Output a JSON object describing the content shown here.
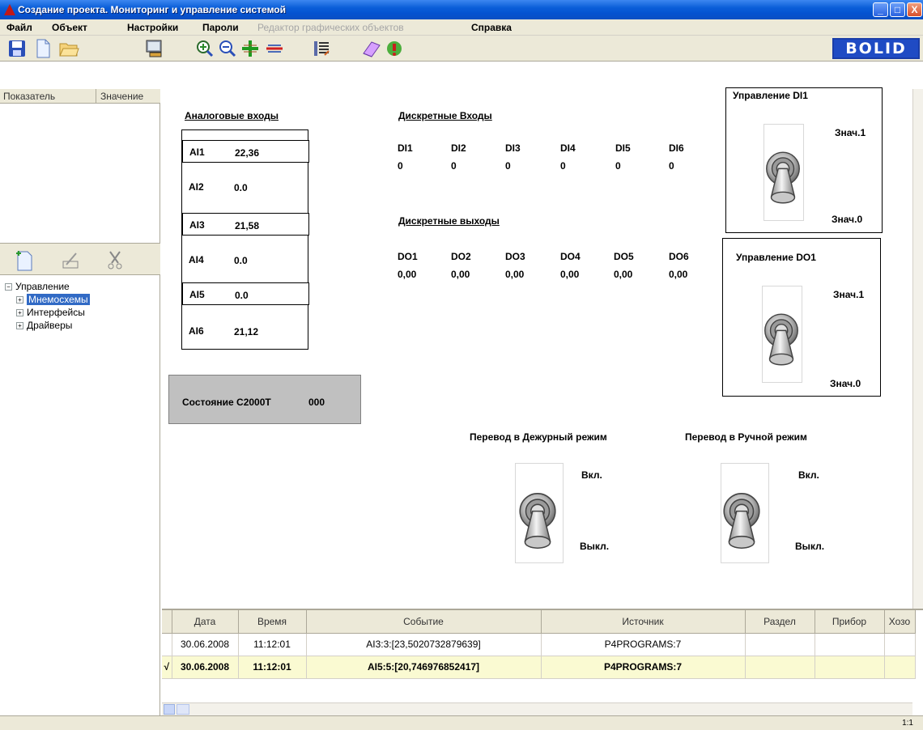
{
  "window": {
    "title": "Создание проекта. Мониторинг и управление системой",
    "min": "_",
    "max": "□",
    "close": "X"
  },
  "menu": [
    "Файл",
    "Объект",
    "Настройки",
    "Пароли",
    "Редактор графических объектов",
    "Справка"
  ],
  "logo": "BOLID",
  "left_panel": {
    "col_indicator": "Показатель",
    "col_value": "Значение",
    "tree": {
      "root": "Управление",
      "items": [
        "Мнемосхемы",
        "Интерфейсы",
        "Драйверы"
      ],
      "selected": "Мнемосхемы"
    }
  },
  "analog": {
    "header": "Аналоговые входы",
    "rows": [
      {
        "label": "AI1",
        "value": "22,36"
      },
      {
        "label": "AI2",
        "value": "0.0"
      },
      {
        "label": "AI3",
        "value": "21,58"
      },
      {
        "label": "AI4",
        "value": "0.0"
      },
      {
        "label": "AI5",
        "value": "0.0"
      },
      {
        "label": "AI6",
        "value": "21,12"
      }
    ]
  },
  "discrete_in": {
    "header": "Дискретные Входы",
    "items": [
      {
        "label": "DI1",
        "value": "0"
      },
      {
        "label": "DI2",
        "value": "0"
      },
      {
        "label": "DI3",
        "value": "0"
      },
      {
        "label": "DI4",
        "value": "0"
      },
      {
        "label": "DI5",
        "value": "0"
      },
      {
        "label": "DI6",
        "value": "0"
      }
    ]
  },
  "discrete_out": {
    "header": "Дискретные выходы",
    "items": [
      {
        "label": "DO1",
        "value": "0,00"
      },
      {
        "label": "DO2",
        "value": "0,00"
      },
      {
        "label": "DO3",
        "value": "0,00"
      },
      {
        "label": "DO4",
        "value": "0,00"
      },
      {
        "label": "DO5",
        "value": "0,00"
      },
      {
        "label": "DO6",
        "value": "0,00"
      }
    ]
  },
  "status": {
    "label": "Состояние С2000Т",
    "value": "000"
  },
  "control_di1": {
    "title": "Управление DI1",
    "on": "Знач.1",
    "off": "Знач.0"
  },
  "control_do1": {
    "title": "Управление DO1",
    "on": "Знач.1",
    "off": "Знач.0"
  },
  "mode_duty": {
    "title": "Перевод в Дежурный режим",
    "on": "Вкл.",
    "off": "Выкл."
  },
  "mode_manual": {
    "title": "Перевод в Ручной режим",
    "on": "Вкл.",
    "off": "Выкл."
  },
  "events": {
    "columns": [
      "Дата",
      "Время",
      "Событие",
      "Источник",
      "Раздел",
      "Прибор",
      "Хозо"
    ],
    "rows": [
      [
        "30.06.2008",
        "11:12:01",
        "AI3:3:[23,5020732879639]",
        "P4PROGRAMS:7",
        "",
        "",
        ""
      ],
      [
        "30.06.2008",
        "11:12:01",
        "AI5:5:[20,746976852417]",
        "P4PROGRAMS:7",
        "",
        "",
        ""
      ]
    ],
    "active_marker": "√"
  },
  "statusbar": {
    "zoom": "1:1"
  }
}
